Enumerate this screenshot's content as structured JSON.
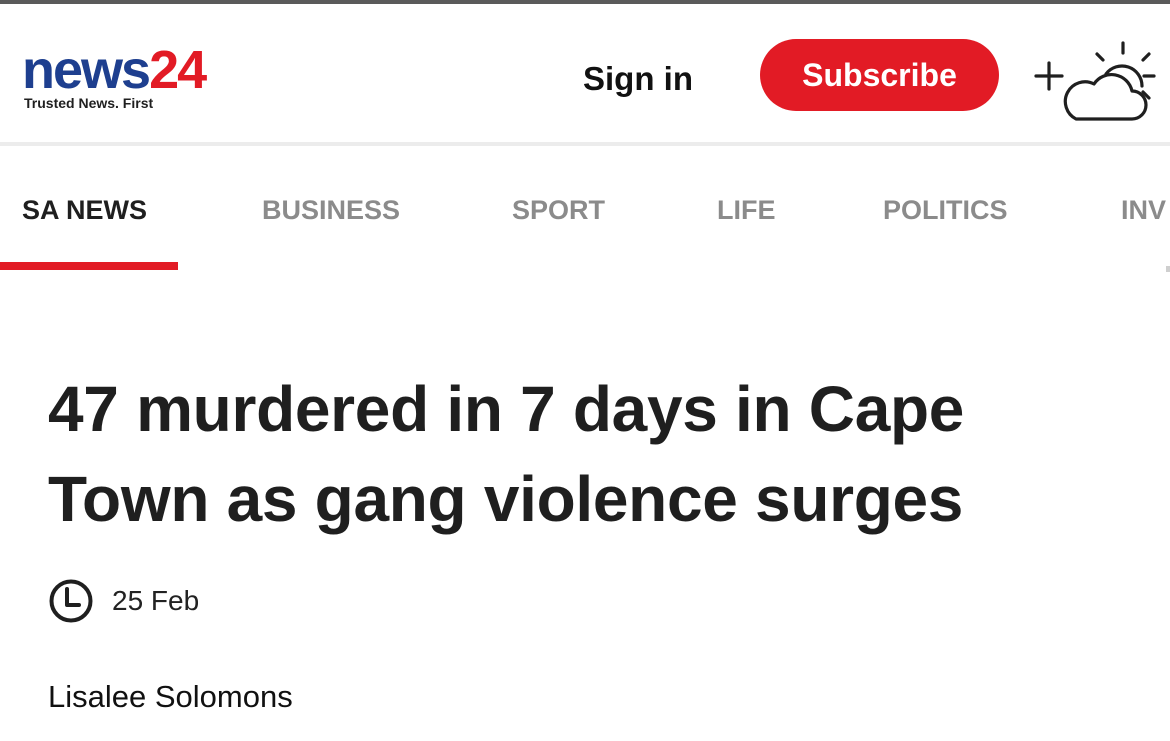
{
  "header": {
    "logo": {
      "word": "news",
      "number": "24",
      "tagline": "Trusted News. First"
    },
    "sign_in_label": "Sign in",
    "subscribe_label": "Subscribe",
    "weather_icon": "partly-cloudy-add-icon",
    "colors": {
      "brand_blue": "#1e3f8f",
      "brand_red": "#e21b25"
    }
  },
  "nav": {
    "items": [
      {
        "label": "SA NEWS",
        "active": true
      },
      {
        "label": "BUSINESS",
        "active": false
      },
      {
        "label": "SPORT",
        "active": false
      },
      {
        "label": "LIFE",
        "active": false
      },
      {
        "label": "POLITICS",
        "active": false
      },
      {
        "label": "INV",
        "active": false
      }
    ]
  },
  "article": {
    "headline": "47 murdered in 7 days in Cape Town as gang violence surges",
    "date": "25 Feb",
    "date_icon": "clock-icon",
    "author": "Lisalee Solomons"
  }
}
